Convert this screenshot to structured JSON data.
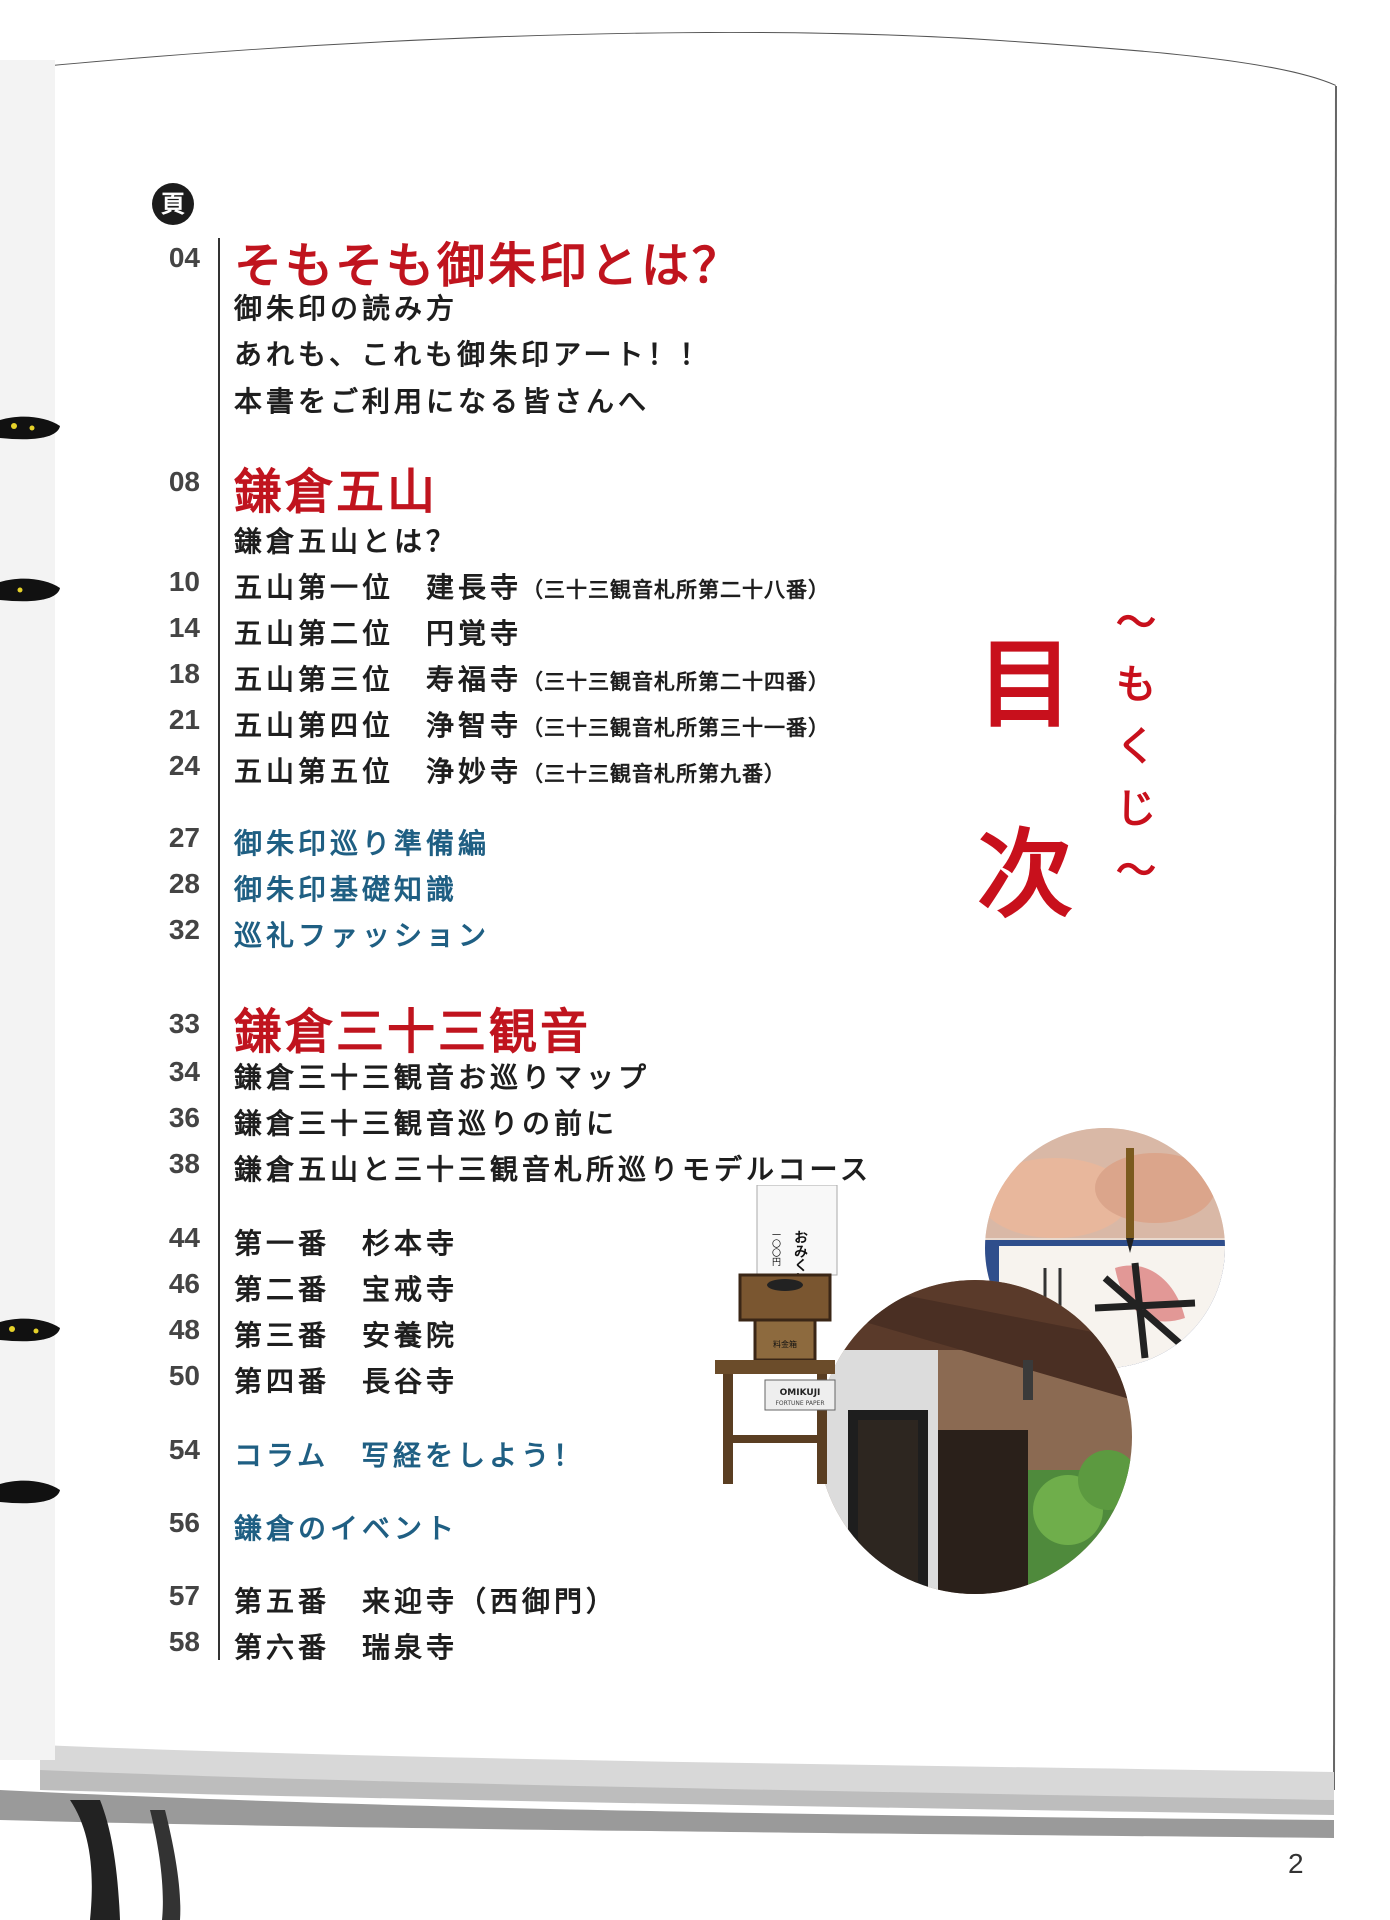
{
  "header": {
    "badge": "頁"
  },
  "title": {
    "main": [
      "目",
      "次"
    ],
    "sub": [
      "〜",
      "も",
      "く",
      "じ",
      "〜"
    ]
  },
  "toc": [
    {
      "num": "04",
      "text": "そもそも御朱印とは？",
      "style": "head"
    },
    {
      "num": "",
      "text": "御朱印の読み方",
      "style": "item"
    },
    {
      "num": "",
      "text": "あれも、これも御朱印アート！！",
      "style": "item"
    },
    {
      "num": "",
      "text": "本書をご利用になる皆さんへ",
      "style": "item"
    },
    {
      "num": "08",
      "text": "鎌倉五山",
      "style": "head"
    },
    {
      "num": "",
      "text": "鎌倉五山とは？",
      "style": "item"
    },
    {
      "num": "10",
      "text": "五山第一位　建長寺",
      "sub": "（三十三観音札所第二十八番）",
      "style": "item"
    },
    {
      "num": "14",
      "text": "五山第二位　円覚寺",
      "style": "item"
    },
    {
      "num": "18",
      "text": "五山第三位　寿福寺",
      "sub": "（三十三観音札所第二十四番）",
      "style": "item"
    },
    {
      "num": "21",
      "text": "五山第四位　浄智寺",
      "sub": "（三十三観音札所第三十一番）",
      "style": "item"
    },
    {
      "num": "24",
      "text": "五山第五位　浄妙寺",
      "sub": "（三十三観音札所第九番）",
      "style": "item"
    },
    {
      "num": "27",
      "text": "御朱印巡り準備編",
      "style": "blue"
    },
    {
      "num": "28",
      "text": "御朱印基礎知識",
      "style": "blue"
    },
    {
      "num": "32",
      "text": "巡礼ファッション",
      "style": "blue"
    },
    {
      "num": "33",
      "text": "鎌倉三十三観音",
      "style": "head"
    },
    {
      "num": "34",
      "text": "鎌倉三十三観音お巡りマップ",
      "style": "item"
    },
    {
      "num": "36",
      "text": "鎌倉三十三観音巡りの前に",
      "style": "item"
    },
    {
      "num": "38",
      "text": "鎌倉五山と三十三観音札所巡りモデルコース",
      "style": "item"
    },
    {
      "num": "44",
      "text": "第一番　杉本寺",
      "style": "item"
    },
    {
      "num": "46",
      "text": "第二番　宝戒寺",
      "style": "item"
    },
    {
      "num": "48",
      "text": "第三番　安養院",
      "style": "item"
    },
    {
      "num": "50",
      "text": "第四番　長谷寺",
      "style": "item"
    },
    {
      "num": "54",
      "text": "コラム　写経をしよう！",
      "style": "blue"
    },
    {
      "num": "56",
      "text": "鎌倉のイベント",
      "style": "blue"
    },
    {
      "num": "57",
      "text": "第五番　来迎寺（西御門）",
      "style": "item"
    },
    {
      "num": "58",
      "text": "第六番　瑞泉寺",
      "style": "item"
    }
  ],
  "photos": {
    "omikuji_sign": [
      "おみくじ",
      "一〇〇円"
    ],
    "box_label": "料金箱",
    "fortune_label": "OMIKUJI",
    "fortune_sub": "FORTUNE PAPER"
  },
  "page_number": "2",
  "colors": {
    "red": "#c0141e",
    "blue": "#1f5f83",
    "text": "#1e1e1e"
  }
}
